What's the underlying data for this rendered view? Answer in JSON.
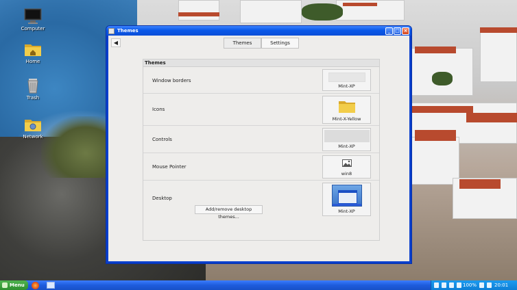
{
  "desktop": {
    "icons": [
      {
        "label": "Computer",
        "icon": "computer-icon"
      },
      {
        "label": "Home",
        "icon": "home-folder-icon"
      },
      {
        "label": "Trash",
        "icon": "trash-icon"
      },
      {
        "label": "Network",
        "icon": "network-folder-icon"
      }
    ]
  },
  "window": {
    "title": "Themes",
    "buttons": {
      "minimize": "minimize-icon",
      "maximize": "maximize-icon",
      "close": "close-icon"
    },
    "back_icon": "back-arrow-icon",
    "tabs": [
      {
        "label": "Themes",
        "active": true
      },
      {
        "label": "Settings",
        "active": false
      }
    ],
    "section_title": "Themes",
    "rows": [
      {
        "label": "Window borders",
        "value": "Mint-XP"
      },
      {
        "label": "Icons",
        "value": "Mint-X-Yellow"
      },
      {
        "label": "Controls",
        "value": "Mint-XP"
      },
      {
        "label": "Mouse Pointer",
        "value": "win8"
      },
      {
        "label": "Desktop",
        "value": "Mint-XP",
        "button": "Add/remove desktop themes..."
      }
    ]
  },
  "taskbar": {
    "menu_label": "Menu",
    "tray": {
      "battery": "100%",
      "clock": "20:01"
    }
  },
  "colors": {
    "title_blue": "#0a58e8",
    "taskbar_blue": "#1e5cdc",
    "menu_green": "#2e8f2e",
    "folder_yellow": "#f2cd4a"
  }
}
